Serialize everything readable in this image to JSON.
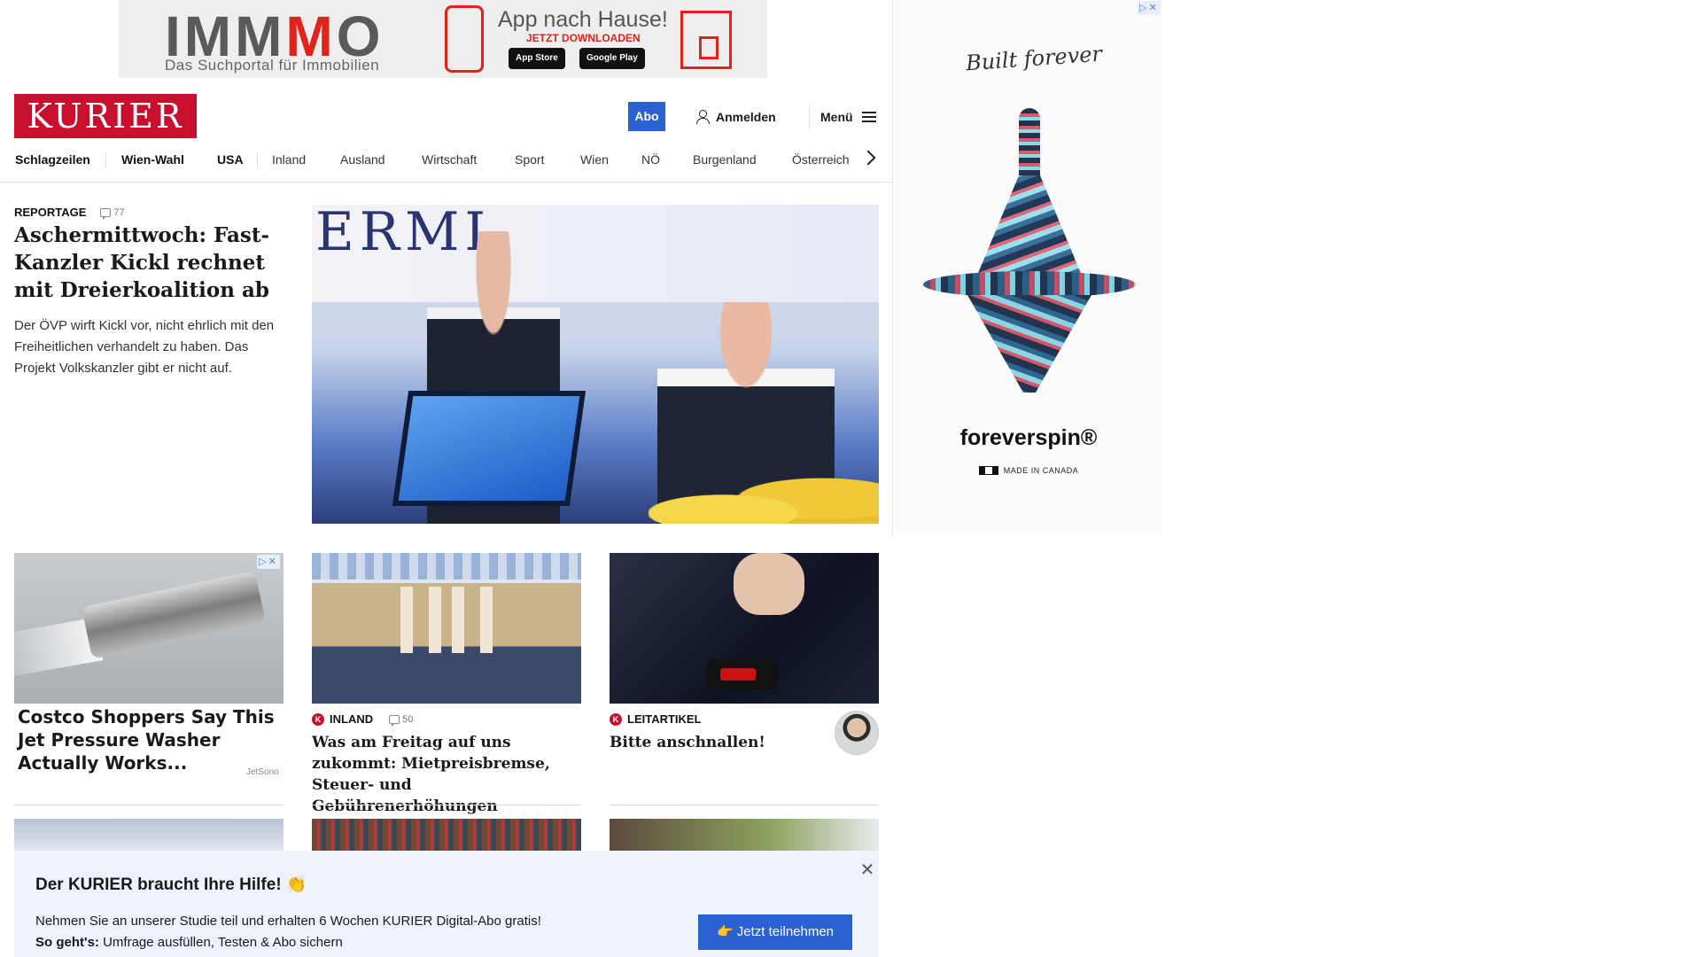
{
  "top_ad": {
    "brand_left": "IMM",
    "brand_red": "M",
    "brand_right": "O",
    "slogan": "Das Suchportal für Immobilien",
    "app_title": "App nach Hause!",
    "download": "JETZT DOWNLOADEN",
    "app_store": "App Store",
    "google_play": "Google Play",
    "ad_mark": "▷✕"
  },
  "header": {
    "logo": "KURIER",
    "abo": "Abo",
    "login": "Anmelden",
    "menu": "Menü"
  },
  "nav": {
    "items": [
      "Schlagzeilen",
      "Wien-Wahl",
      "USA",
      "Inland",
      "Ausland",
      "Wirtschaft",
      "Sport",
      "Wien",
      "NÖ",
      "Burgenland",
      "Österreich"
    ]
  },
  "lead": {
    "kicker": "REPORTAGE",
    "comments": "77",
    "title": "Aschermittwoch: Fast-Kanzler Kickl rechnet mit Dreierkoalition ab",
    "text": "Der ÖVP wirft Kickl vor, nicht ehrlich mit den Freiheitlichen verhandelt zu haben. Das Projekt Volkskanzler gibt er nicht auf."
  },
  "cards": {
    "ad": {
      "title": "Costco Shoppers Say This Jet Pressure Washer Actually Works...",
      "source": "JetSono"
    },
    "inland": {
      "kicker": "INLAND",
      "comments": "50",
      "title": "Was am Freitag auf uns zukommt: Mietpreisbremse, Steuer- und Gebührenerhöhungen"
    },
    "leitartikel": {
      "kicker": "LEITARTIKEL",
      "title": "Bitte anschnallen!"
    },
    "k_badge": "K"
  },
  "side_ad": {
    "script": "Built forever",
    "brand": "foreverspin®",
    "made": "MADE IN CANADA"
  },
  "popup": {
    "title": "Der KURIER braucht Ihre Hilfe! 👏",
    "line1": "Nehmen Sie an unserer Studie teil und erhalten 6 Wochen KURIER Digital-Abo gratis!",
    "line2_bold": "So geht's:",
    "line2": " Umfrage ausfüllen, Testen & Abo sichern",
    "button": "👉 Jetzt teilnehmen",
    "close": "✕"
  },
  "colors": {
    "brand_red": "#c8102e",
    "accent_blue": "#2a62d4"
  }
}
